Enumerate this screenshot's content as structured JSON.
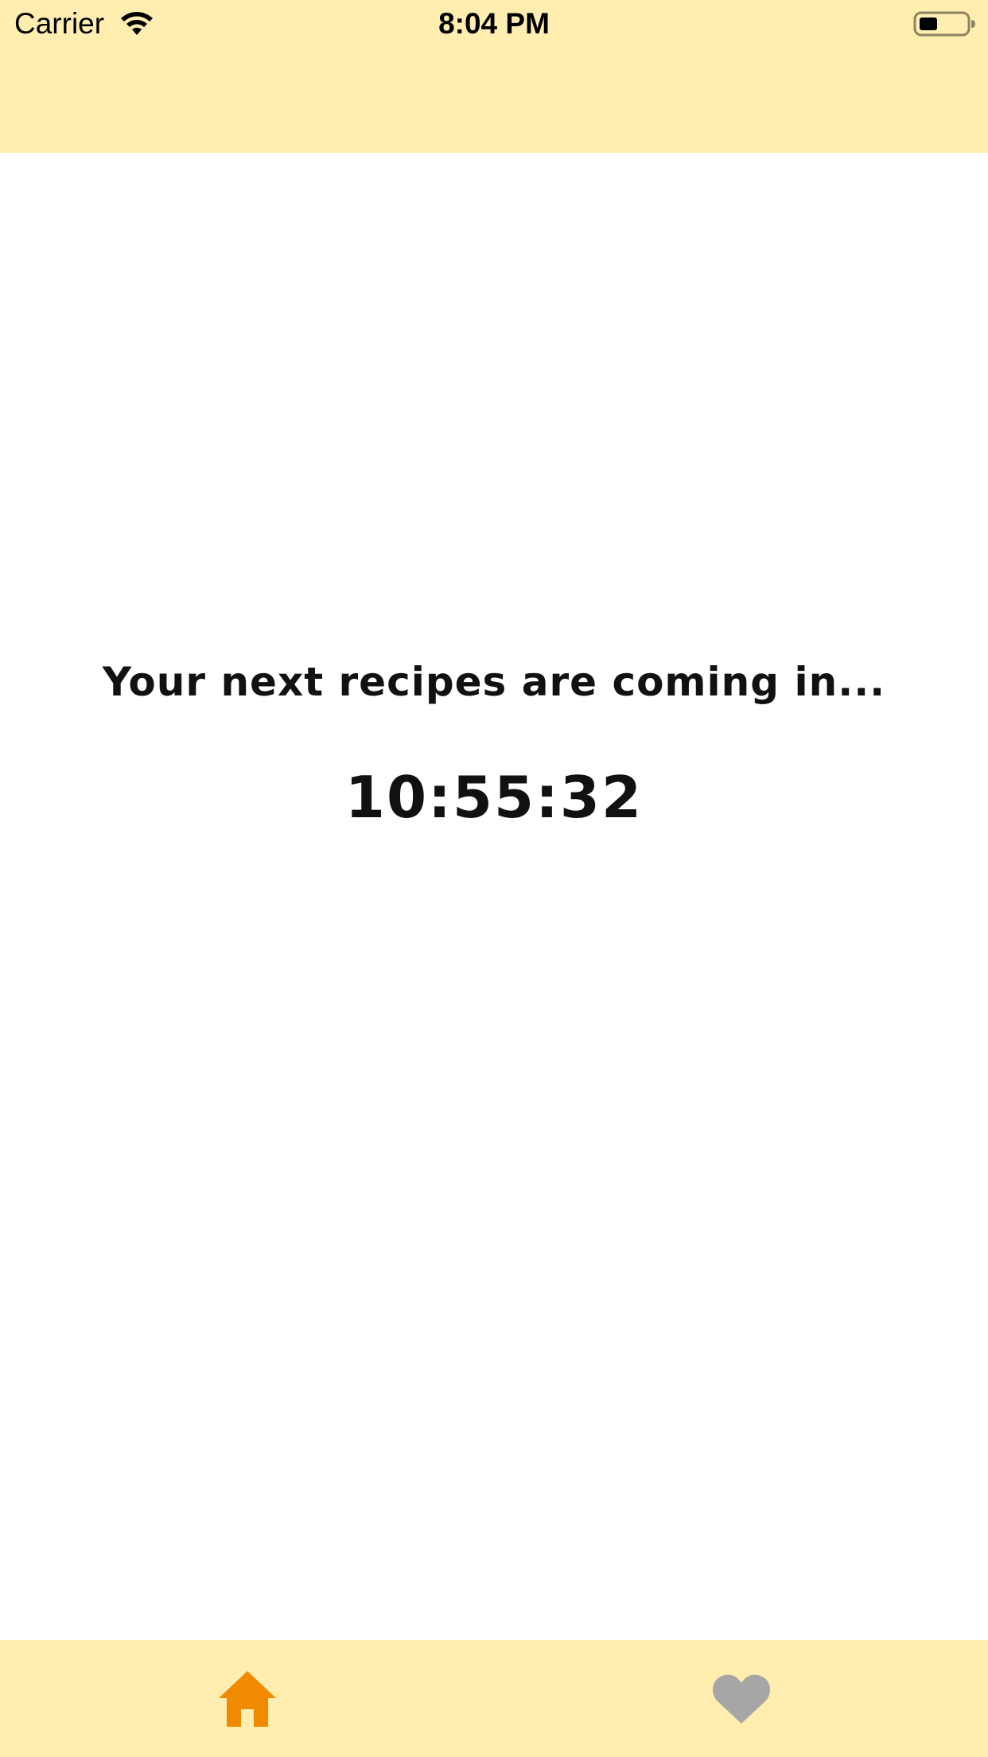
{
  "status_bar": {
    "carrier": "Carrier",
    "time": "8:04 PM",
    "wifi_icon": "wifi-icon",
    "battery_icon": "battery-icon"
  },
  "main": {
    "headline": "Your next recipes are coming in...",
    "countdown": "10:55:32"
  },
  "tab_bar": {
    "items": [
      {
        "icon": "home-icon",
        "selected": true,
        "color": "#F08A00"
      },
      {
        "icon": "heart-icon",
        "selected": false,
        "color": "#A6A6A6"
      }
    ]
  },
  "colors": {
    "bar_background": "#FFEEB0",
    "content_background": "#FFFFFF",
    "accent": "#F08A00",
    "inactive": "#A6A6A6"
  }
}
